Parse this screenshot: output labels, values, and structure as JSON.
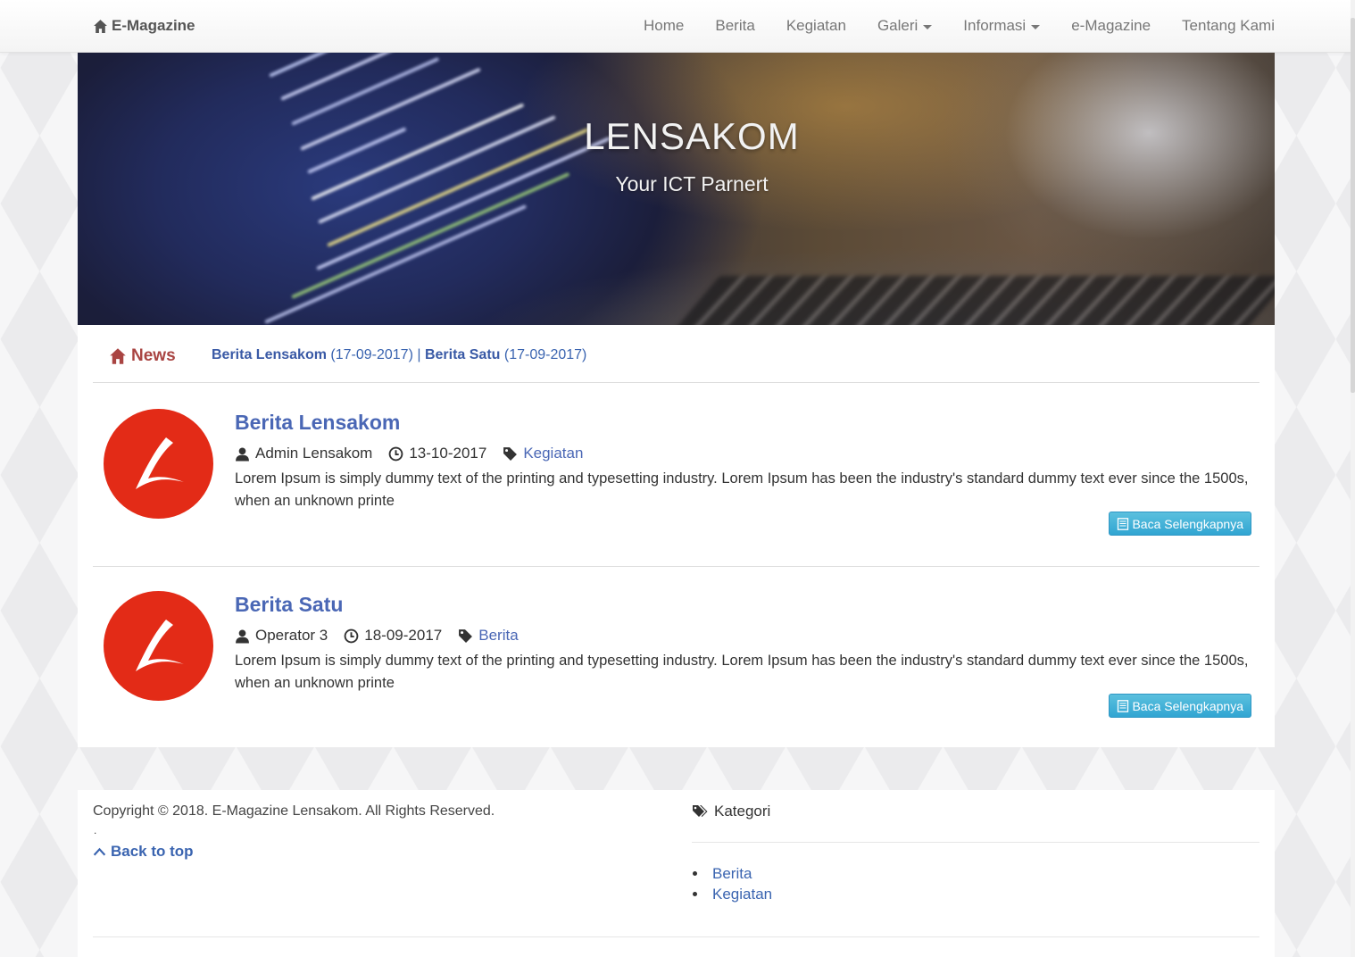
{
  "navbar": {
    "brand": "E-Magazine",
    "items": [
      {
        "label": "Home",
        "dropdown": false
      },
      {
        "label": "Berita",
        "dropdown": false
      },
      {
        "label": "Kegiatan",
        "dropdown": false
      },
      {
        "label": "Galeri",
        "dropdown": true
      },
      {
        "label": "Informasi",
        "dropdown": true
      },
      {
        "label": "e-Magazine",
        "dropdown": false
      },
      {
        "label": "Tentang Kami",
        "dropdown": false
      }
    ]
  },
  "hero": {
    "title": "LENSAKOM",
    "subtitle": "Your ICT Parnert"
  },
  "ticker": {
    "label": "News",
    "items": [
      {
        "title": "Berita Lensakom",
        "date": "(17-09-2017)"
      },
      {
        "title": "Berita Satu",
        "date": "(17-09-2017)"
      }
    ],
    "separator": "|"
  },
  "articles": [
    {
      "title": "Berita Lensakom",
      "author": "Admin Lensakom",
      "date": "13-10-2017",
      "category": "Kegiatan",
      "excerpt": "Lorem Ipsum is simply dummy text of the printing and typesetting industry. Lorem Ipsum has been the industry's standard dummy text ever since the 1500s, when an unknown printe",
      "button": "Baca Selengkapnya"
    },
    {
      "title": "Berita Satu",
      "author": "Operator 3",
      "date": "18-09-2017",
      "category": "Berita",
      "excerpt": "Lorem Ipsum is simply dummy text of the printing and typesetting industry. Lorem Ipsum has been the industry's standard dummy text ever since the 1500s, when an unknown printe",
      "button": "Baca Selengkapnya"
    }
  ],
  "footer": {
    "copyright": "Copyright © 2018. E-Magazine Lensakom. All Rights Reserved.",
    "dot": ".",
    "back_to_top": "Back to top",
    "kategori_title": "Kategori",
    "kategori_items": [
      "Berita",
      "Kegiatan"
    ]
  },
  "colors": {
    "link": "#4a67b5",
    "news_label": "#a94442",
    "button": "#5bc0de",
    "avatar": "#e32b17"
  }
}
